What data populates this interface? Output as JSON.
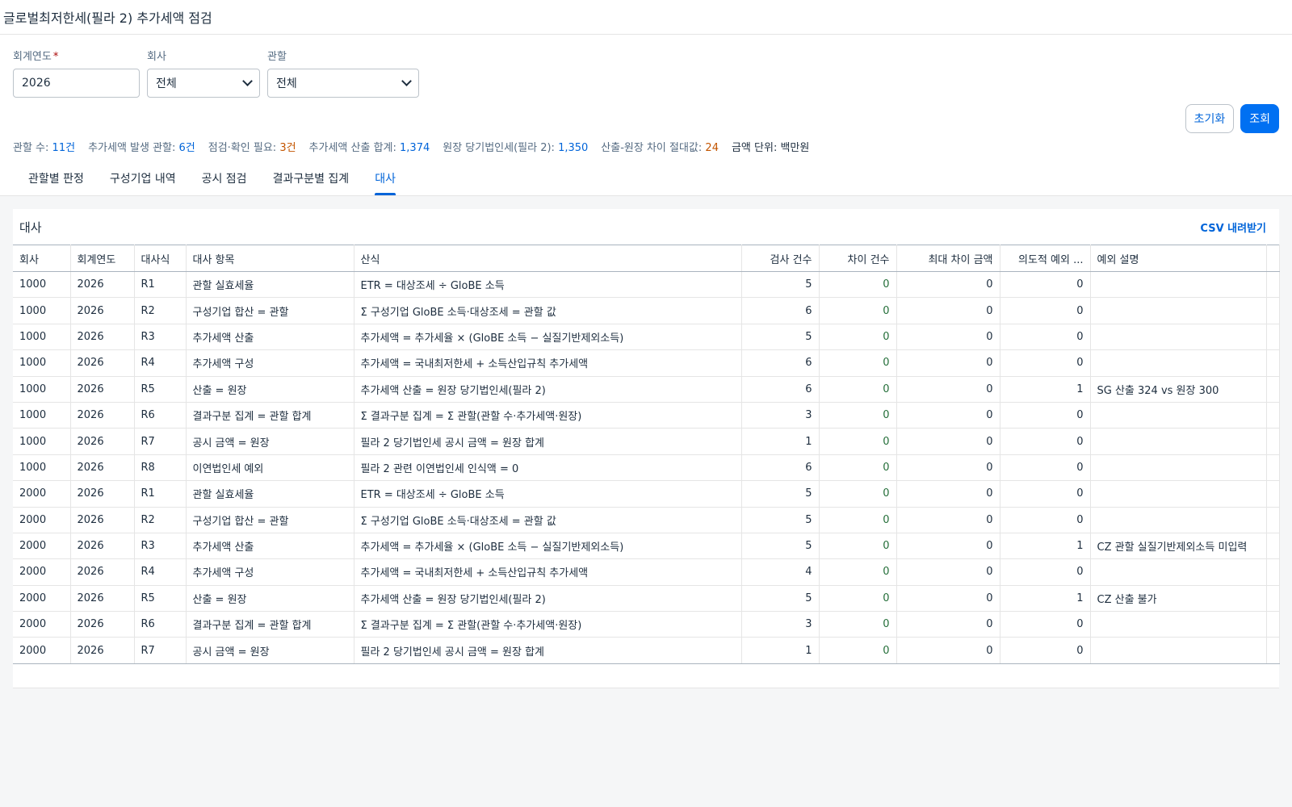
{
  "header": {
    "title": "글로벌최저한세(필라 2) 추가세액 점검"
  },
  "filters": {
    "fiscal_year": {
      "label": "회계연도",
      "required_mark": "*",
      "value": "2026"
    },
    "company": {
      "label": "회사",
      "value": "전체"
    },
    "jurisdiction": {
      "label": "관할",
      "value": "전체"
    }
  },
  "actions": {
    "reset_label": "초기화",
    "search_label": "조회"
  },
  "summary": {
    "jurisdiction_count": {
      "label": "관할 수:",
      "value": "11건"
    },
    "topup_jurisdictions": {
      "label": "추가세액 발생 관할:",
      "value": "6건"
    },
    "check_needed": {
      "label": "점검·확인 필요:",
      "value": "3건"
    },
    "topup_total": {
      "label": "추가세액 산출 합계:",
      "value": "1,374"
    },
    "ledger_tax": {
      "label": "원장 당기법인세(필라 2):",
      "value": "1,350"
    },
    "abs_diff": {
      "label": "산출-원장 차이 절대값:",
      "value": "24"
    },
    "unit": {
      "label": "금액 단위:",
      "value": "백만원"
    }
  },
  "tabs": [
    {
      "label": "관할별 판정"
    },
    {
      "label": "구성기업 내역"
    },
    {
      "label": "공시 점검"
    },
    {
      "label": "결과구분별 집계"
    },
    {
      "label": "대사"
    }
  ],
  "card": {
    "title": "대사",
    "csv_label": "CSV 내려받기"
  },
  "table": {
    "columns": [
      "회사",
      "회계연도",
      "대사식",
      "대사 항목",
      "산식",
      "검사 건수",
      "차이 건수",
      "최대 차이 금액",
      "의도적 예외 ...",
      "예외 설명"
    ],
    "rows": [
      [
        "1000",
        "2026",
        "R1",
        "관할 실효세율",
        "ETR = 대상조세 ÷ GloBE 소득",
        "5",
        "0",
        "0",
        "0",
        ""
      ],
      [
        "1000",
        "2026",
        "R2",
        "구성기업 합산 = 관할",
        "Σ 구성기업 GloBE 소득·대상조세 = 관할 값",
        "6",
        "0",
        "0",
        "0",
        ""
      ],
      [
        "1000",
        "2026",
        "R3",
        "추가세액 산출",
        "추가세액 = 추가세율 × (GloBE 소득 − 실질기반제외소득)",
        "5",
        "0",
        "0",
        "0",
        ""
      ],
      [
        "1000",
        "2026",
        "R4",
        "추가세액 구성",
        "추가세액 = 국내최저한세 + 소득산입규칙 추가세액",
        "6",
        "0",
        "0",
        "0",
        ""
      ],
      [
        "1000",
        "2026",
        "R5",
        "산출 = 원장",
        "추가세액 산출 = 원장 당기법인세(필라 2)",
        "6",
        "0",
        "0",
        "1",
        "SG 산출 324 vs 원장 300"
      ],
      [
        "1000",
        "2026",
        "R6",
        "결과구분 집계 = 관할 합계",
        "Σ 결과구분 집계 = Σ 관할(관할 수·추가세액·원장)",
        "3",
        "0",
        "0",
        "0",
        ""
      ],
      [
        "1000",
        "2026",
        "R7",
        "공시 금액 = 원장",
        "필라 2 당기법인세 공시 금액 = 원장 합계",
        "1",
        "0",
        "0",
        "0",
        ""
      ],
      [
        "1000",
        "2026",
        "R8",
        "이연법인세 예외",
        "필라 2 관련 이연법인세 인식액 = 0",
        "6",
        "0",
        "0",
        "0",
        ""
      ],
      [
        "2000",
        "2026",
        "R1",
        "관할 실효세율",
        "ETR = 대상조세 ÷ GloBE 소득",
        "5",
        "0",
        "0",
        "0",
        ""
      ],
      [
        "2000",
        "2026",
        "R2",
        "구성기업 합산 = 관할",
        "Σ 구성기업 GloBE 소득·대상조세 = 관할 값",
        "5",
        "0",
        "0",
        "0",
        ""
      ],
      [
        "2000",
        "2026",
        "R3",
        "추가세액 산출",
        "추가세액 = 추가세율 × (GloBE 소득 − 실질기반제외소득)",
        "5",
        "0",
        "0",
        "1",
        "CZ 관할 실질기반제외소득 미입력"
      ],
      [
        "2000",
        "2026",
        "R4",
        "추가세액 구성",
        "추가세액 = 국내최저한세 + 소득산입규칙 추가세액",
        "4",
        "0",
        "0",
        "0",
        ""
      ],
      [
        "2000",
        "2026",
        "R5",
        "산출 = 원장",
        "추가세액 산출 = 원장 당기법인세(필라 2)",
        "5",
        "0",
        "0",
        "1",
        "CZ 산출 불가"
      ],
      [
        "2000",
        "2026",
        "R6",
        "결과구분 집계 = 관할 합계",
        "Σ 결과구분 집계 = Σ 관할(관할 수·추가세액·원장)",
        "3",
        "0",
        "0",
        "0",
        ""
      ],
      [
        "2000",
        "2026",
        "R7",
        "공시 금액 = 원장",
        "필라 2 당기법인세 공시 금액 = 원장 합계",
        "1",
        "0",
        "0",
        "0",
        ""
      ]
    ]
  }
}
